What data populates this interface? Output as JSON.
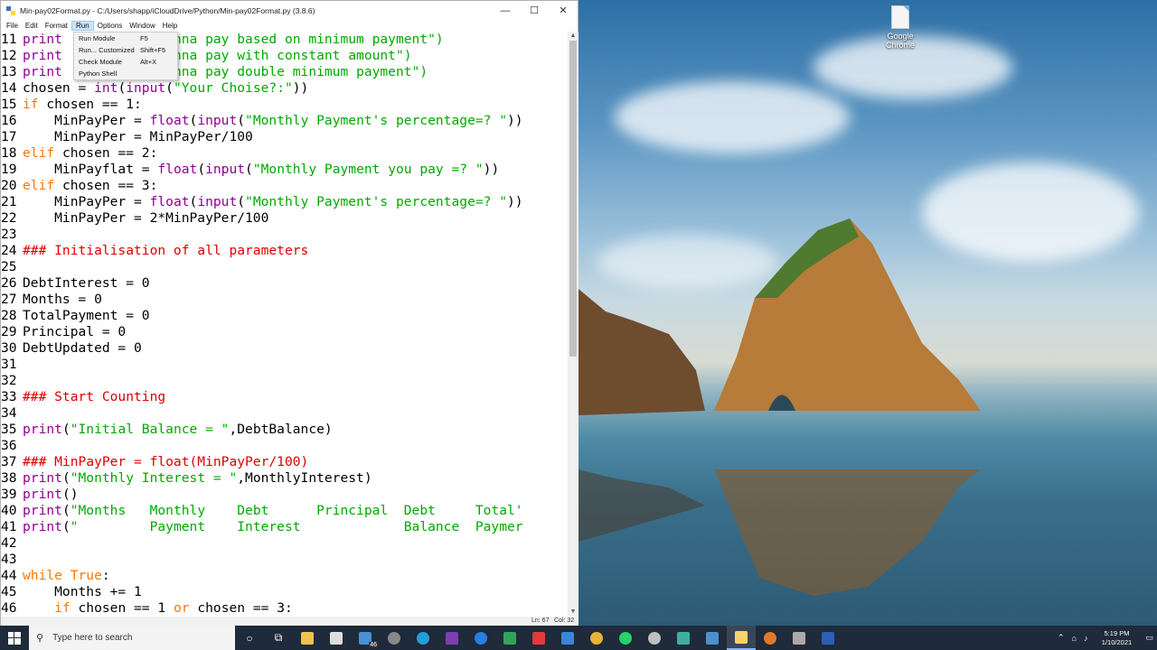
{
  "window": {
    "title": "Min-pay02Format.py - C:/Users/shapp/iCloudDrive/Python/Min-pay02Format.py (3.8.6)",
    "minimize": "—",
    "maximize": "☐",
    "close": "✕"
  },
  "menubar": [
    "File",
    "Edit",
    "Format",
    "Run",
    "Options",
    "Window",
    "Help"
  ],
  "run_menu": [
    {
      "label": "Run Module",
      "accel": "F5"
    },
    {
      "label": "Run... Customized",
      "accel": "Shift+F5"
    },
    {
      "label": "Check Module",
      "accel": "Alt+X"
    },
    {
      "label": "Python Shell",
      "accel": ""
    }
  ],
  "code_lines": [
    {
      "n": "11",
      "tokens": [
        [
          "bi",
          "print"
        ],
        [
          "code",
          "    "
        ],
        [
          "str",
          " if you wanna pay based on minimum payment\")"
        ]
      ]
    },
    {
      "n": "12",
      "tokens": [
        [
          "bi",
          "print"
        ],
        [
          "code",
          "    "
        ],
        [
          "str",
          " if you wanna pay with constant amount\")"
        ]
      ]
    },
    {
      "n": "13",
      "tokens": [
        [
          "bi",
          "print"
        ],
        [
          "code",
          "    "
        ],
        [
          "str",
          " if you wanna pay double minimum payment\")"
        ]
      ]
    },
    {
      "n": "14",
      "tokens": [
        [
          "code",
          "chosen = "
        ],
        [
          "bi",
          "int"
        ],
        [
          "code",
          "("
        ],
        [
          "bi",
          "input"
        ],
        [
          "code",
          "("
        ],
        [
          "str",
          "\"Your Choise?:\""
        ],
        [
          "code",
          "))"
        ]
      ]
    },
    {
      "n": "15",
      "tokens": [
        [
          "kw",
          "if"
        ],
        [
          "code",
          " chosen == 1:"
        ]
      ]
    },
    {
      "n": "16",
      "tokens": [
        [
          "code",
          "    MinPayPer = "
        ],
        [
          "bi",
          "float"
        ],
        [
          "code",
          "("
        ],
        [
          "bi",
          "input"
        ],
        [
          "code",
          "("
        ],
        [
          "str",
          "\"Monthly Payment's percentage=? \""
        ],
        [
          "code",
          "))"
        ]
      ]
    },
    {
      "n": "17",
      "tokens": [
        [
          "code",
          "    MinPayPer = MinPayPer/100"
        ]
      ]
    },
    {
      "n": "18",
      "tokens": [
        [
          "kw",
          "elif"
        ],
        [
          "code",
          " chosen == 2:"
        ]
      ]
    },
    {
      "n": "19",
      "tokens": [
        [
          "code",
          "    MinPayflat = "
        ],
        [
          "bi",
          "float"
        ],
        [
          "code",
          "("
        ],
        [
          "bi",
          "input"
        ],
        [
          "code",
          "("
        ],
        [
          "str",
          "\"Monthly Payment you pay =? \""
        ],
        [
          "code",
          "))"
        ]
      ]
    },
    {
      "n": "20",
      "tokens": [
        [
          "kw",
          "elif"
        ],
        [
          "code",
          " chosen == 3:"
        ]
      ]
    },
    {
      "n": "21",
      "tokens": [
        [
          "code",
          "    MinPayPer = "
        ],
        [
          "bi",
          "float"
        ],
        [
          "code",
          "("
        ],
        [
          "bi",
          "input"
        ],
        [
          "code",
          "("
        ],
        [
          "str",
          "\"Monthly Payment's percentage=? \""
        ],
        [
          "code",
          "))"
        ]
      ]
    },
    {
      "n": "22",
      "tokens": [
        [
          "code",
          "    MinPayPer = 2*MinPayPer/100"
        ]
      ]
    },
    {
      "n": "23",
      "tokens": []
    },
    {
      "n": "24",
      "tokens": [
        [
          "com",
          "### Initialisation of all parameters"
        ]
      ]
    },
    {
      "n": "25",
      "tokens": []
    },
    {
      "n": "26",
      "tokens": [
        [
          "code",
          "DebtInterest = 0"
        ]
      ]
    },
    {
      "n": "27",
      "tokens": [
        [
          "code",
          "Months = 0"
        ]
      ]
    },
    {
      "n": "28",
      "tokens": [
        [
          "code",
          "TotalPayment = 0"
        ]
      ]
    },
    {
      "n": "29",
      "tokens": [
        [
          "code",
          "Principal = 0"
        ]
      ]
    },
    {
      "n": "30",
      "tokens": [
        [
          "code",
          "DebtUpdated = 0"
        ]
      ]
    },
    {
      "n": "31",
      "tokens": []
    },
    {
      "n": "32",
      "tokens": []
    },
    {
      "n": "33",
      "tokens": [
        [
          "com",
          "### Start Counting"
        ]
      ]
    },
    {
      "n": "34",
      "tokens": []
    },
    {
      "n": "35",
      "tokens": [
        [
          "bi",
          "print"
        ],
        [
          "code",
          "("
        ],
        [
          "str",
          "\"Initial Balance = \""
        ],
        [
          "code",
          ",DebtBalance)"
        ]
      ]
    },
    {
      "n": "36",
      "tokens": []
    },
    {
      "n": "37",
      "tokens": [
        [
          "com",
          "### MinPayPer = float(MinPayPer/100)"
        ]
      ]
    },
    {
      "n": "38",
      "tokens": [
        [
          "bi",
          "print"
        ],
        [
          "code",
          "("
        ],
        [
          "str",
          "\"Monthly Interest = \""
        ],
        [
          "code",
          ",MonthlyInterest)"
        ]
      ]
    },
    {
      "n": "39",
      "tokens": [
        [
          "bi",
          "print"
        ],
        [
          "code",
          "()"
        ]
      ]
    },
    {
      "n": "40",
      "tokens": [
        [
          "bi",
          "print"
        ],
        [
          "code",
          "("
        ],
        [
          "str",
          "\"Months   Monthly    Debt      Principal  Debt     Total'"
        ]
      ]
    },
    {
      "n": "41",
      "tokens": [
        [
          "bi",
          "print"
        ],
        [
          "code",
          "("
        ],
        [
          "str",
          "\"         Payment    Interest             Balance  Paymer"
        ]
      ]
    },
    {
      "n": "42",
      "tokens": []
    },
    {
      "n": "43",
      "tokens": []
    },
    {
      "n": "44",
      "tokens": [
        [
          "kw",
          "while"
        ],
        [
          "code",
          " "
        ],
        [
          "kw",
          "True"
        ],
        [
          "code",
          ":"
        ]
      ]
    },
    {
      "n": "45",
      "tokens": [
        [
          "code",
          "    Months += 1"
        ]
      ]
    },
    {
      "n": "46",
      "tokens": [
        [
          "code",
          "    "
        ],
        [
          "kw",
          "if"
        ],
        [
          "code",
          " chosen == 1 "
        ],
        [
          "kw",
          "or"
        ],
        [
          "code",
          " chosen == 3:"
        ]
      ]
    }
  ],
  "status": {
    "ln": "Ln: 67",
    "col": "Col: 32"
  },
  "desktop_icon": {
    "label": "Google Chrome"
  },
  "taskbar": {
    "search_placeholder": "Type here to search",
    "clock_time": "5:19 PM",
    "clock_date": "1/10/2021",
    "badge": "46"
  }
}
